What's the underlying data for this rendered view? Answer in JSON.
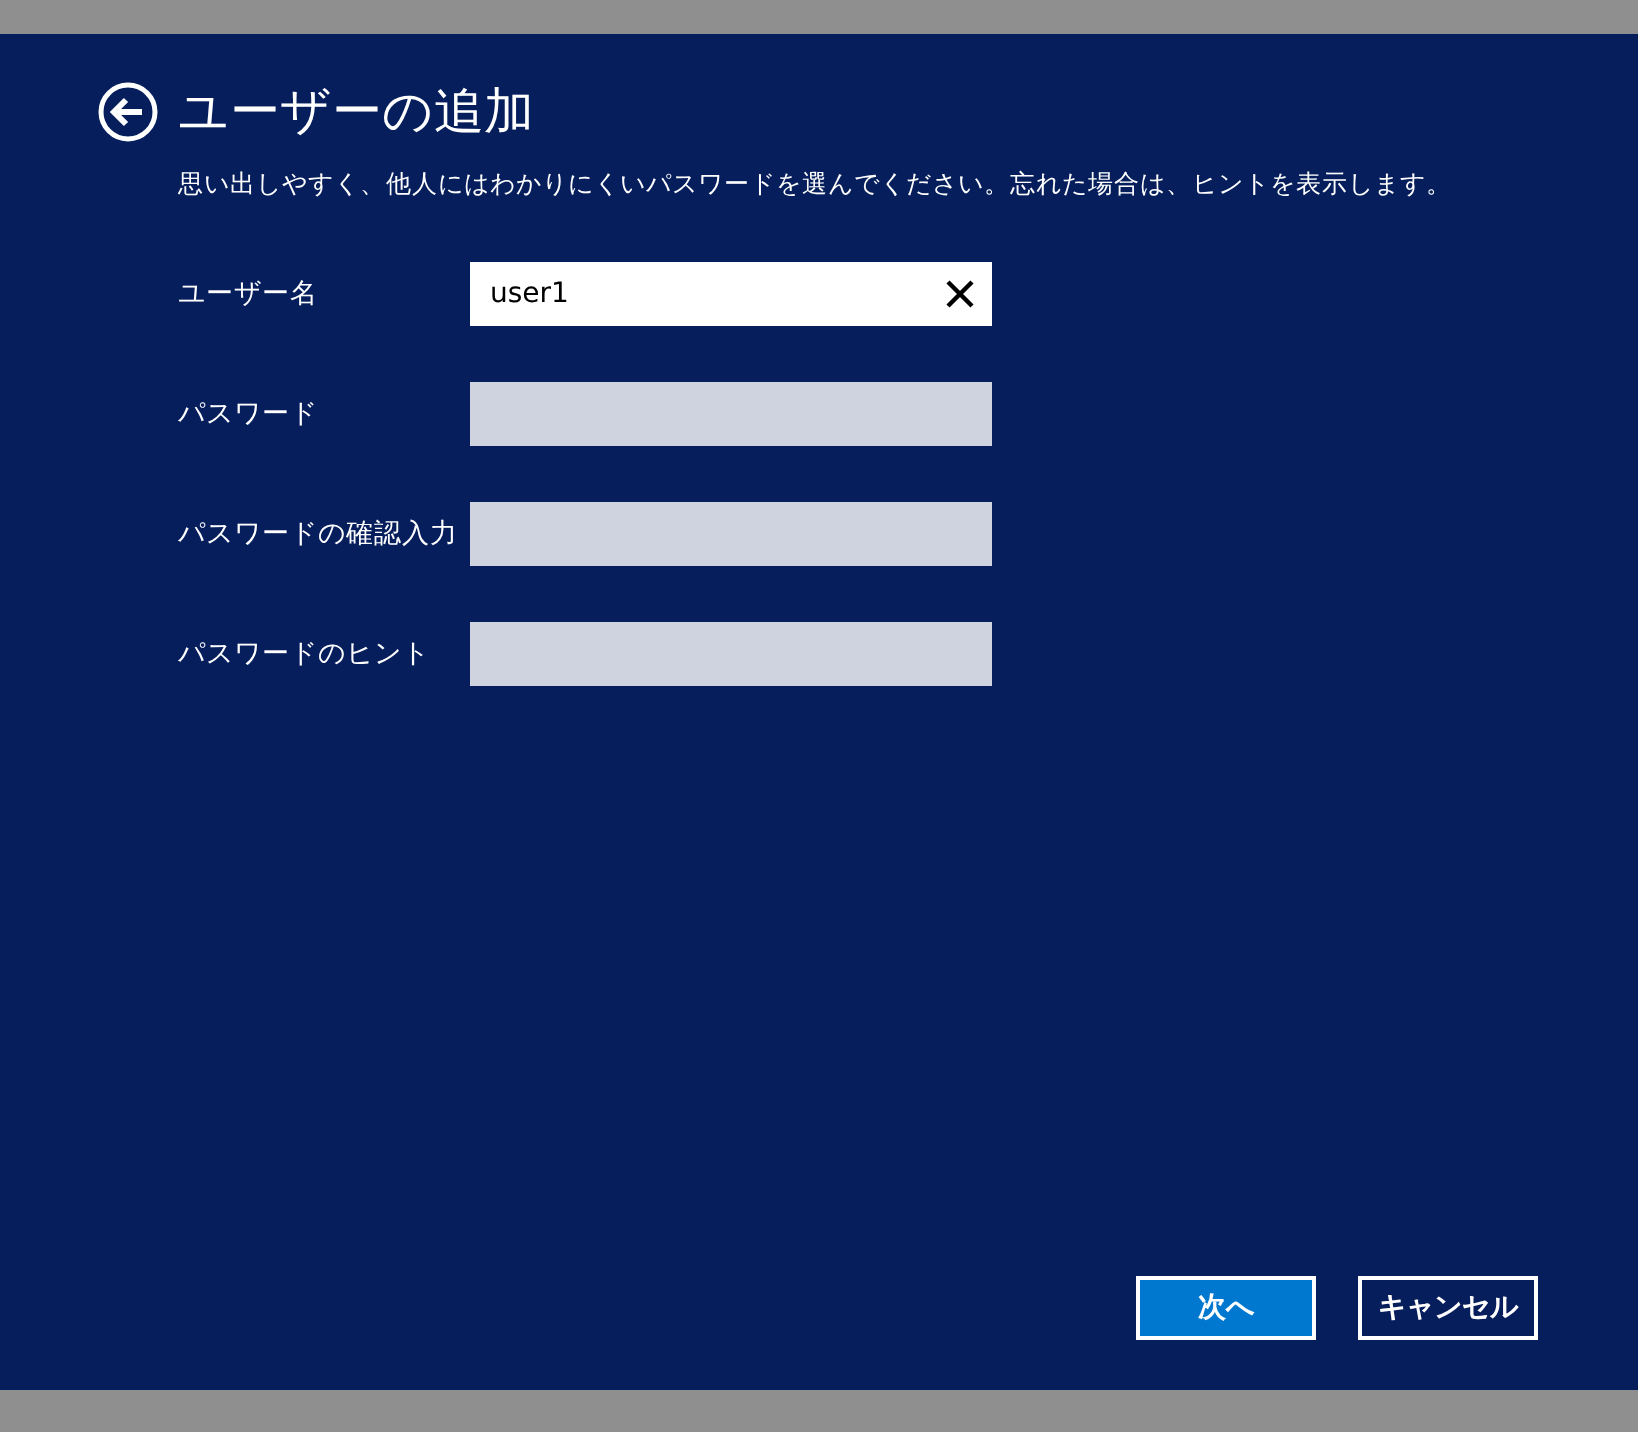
{
  "title": "ユーザーの追加",
  "description": "思い出しやすく、他人にはわかりにくいパスワードを選んでください。忘れた場合は、ヒントを表示します。",
  "fields": [
    {
      "label": "ユーザー名",
      "value": "user1",
      "focused": true
    },
    {
      "label": "パスワード",
      "focused": false
    },
    {
      "label": "パスワードの確認入力",
      "focused": false
    },
    {
      "label": "パスワードのヒント",
      "focused": false
    }
  ],
  "buttons": [
    {
      "label": "次へ",
      "kind": "primary"
    },
    {
      "label": "キャンセル",
      "kind": "secondary"
    }
  ]
}
